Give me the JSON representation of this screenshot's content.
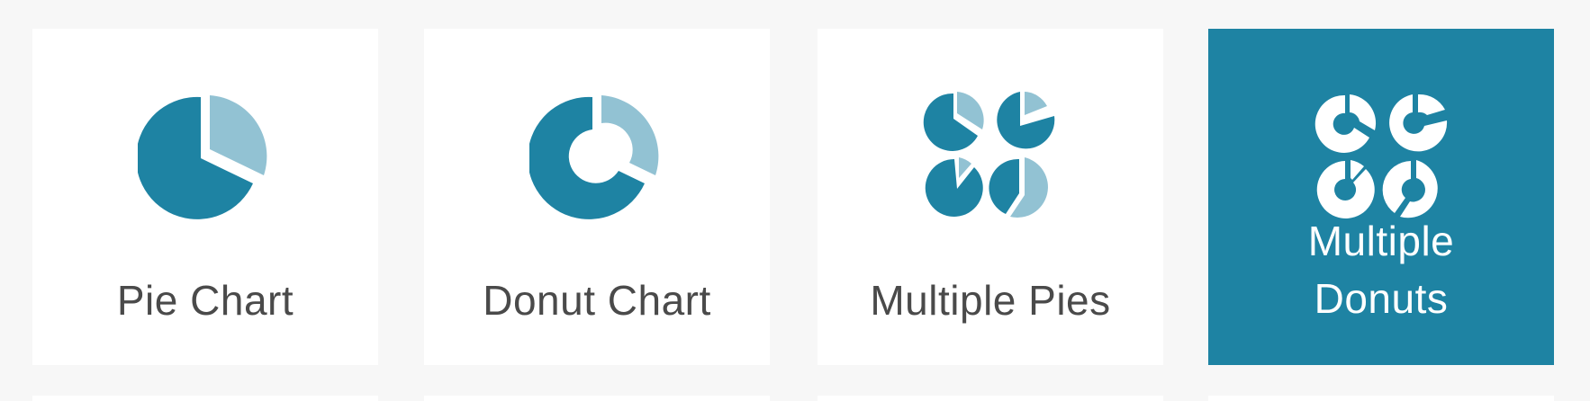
{
  "colors": {
    "background": "#f7f7f7",
    "card": "#ffffff",
    "accent": "#1e83a3",
    "accent_light": "#92c2d3",
    "text": "#4a4a4a",
    "selected_text": "#ffffff"
  },
  "chart_types": [
    {
      "label": "Pie Chart",
      "icon": "pie-chart-icon",
      "selected": false
    },
    {
      "label": "Donut Chart",
      "icon": "donut-chart-icon",
      "selected": false
    },
    {
      "label": "Multiple Pies",
      "icon": "multiple-pies-icon",
      "selected": false
    },
    {
      "label": "Multiple\nDonuts",
      "label_lines": [
        "Multiple",
        "Donuts"
      ],
      "icon": "multiple-donuts-icon",
      "selected": true
    }
  ]
}
